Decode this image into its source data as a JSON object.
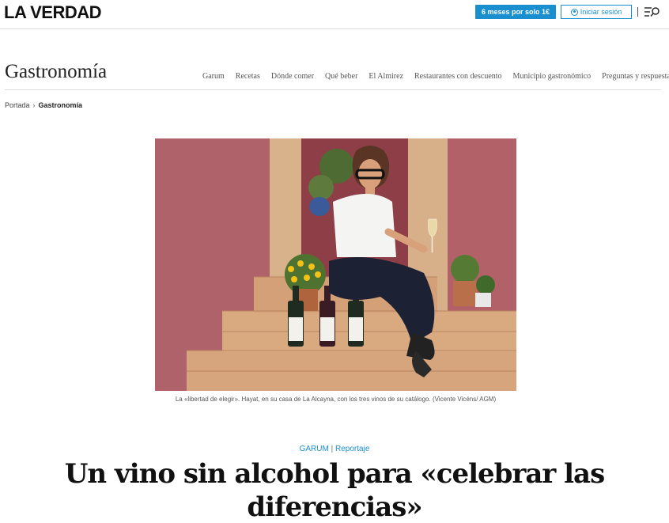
{
  "header": {
    "logo": "LA VERDAD",
    "subscribe_label": "6 meses por solo 1€",
    "login_label": "Iniciar sesión"
  },
  "section": {
    "title": "Gastronomía",
    "nav": [
      "Garum",
      "Recetas",
      "Dónde comer",
      "Qué beber",
      "El Almirez",
      "Restaurantes con descuento",
      "Municipio gastronómico",
      "Preguntas y respuestas"
    ]
  },
  "breadcrumb": {
    "home": "Portada",
    "separator": "›",
    "current": "Gastronomía"
  },
  "photo": {
    "caption": "La «libertad de elegir». Hayat, en su casa de La Alcayna, con los tres vinos de su catálogo. (Vicente Vicéns/ AGM)"
  },
  "article": {
    "section_tag": "GARUM",
    "separator": "|",
    "type_tag": "Reportaje",
    "headline": "Un vino sin alcohol para «celebrar las diferencias»"
  },
  "colors": {
    "accent": "#1a8fcf",
    "wall": "#a85a5e"
  }
}
